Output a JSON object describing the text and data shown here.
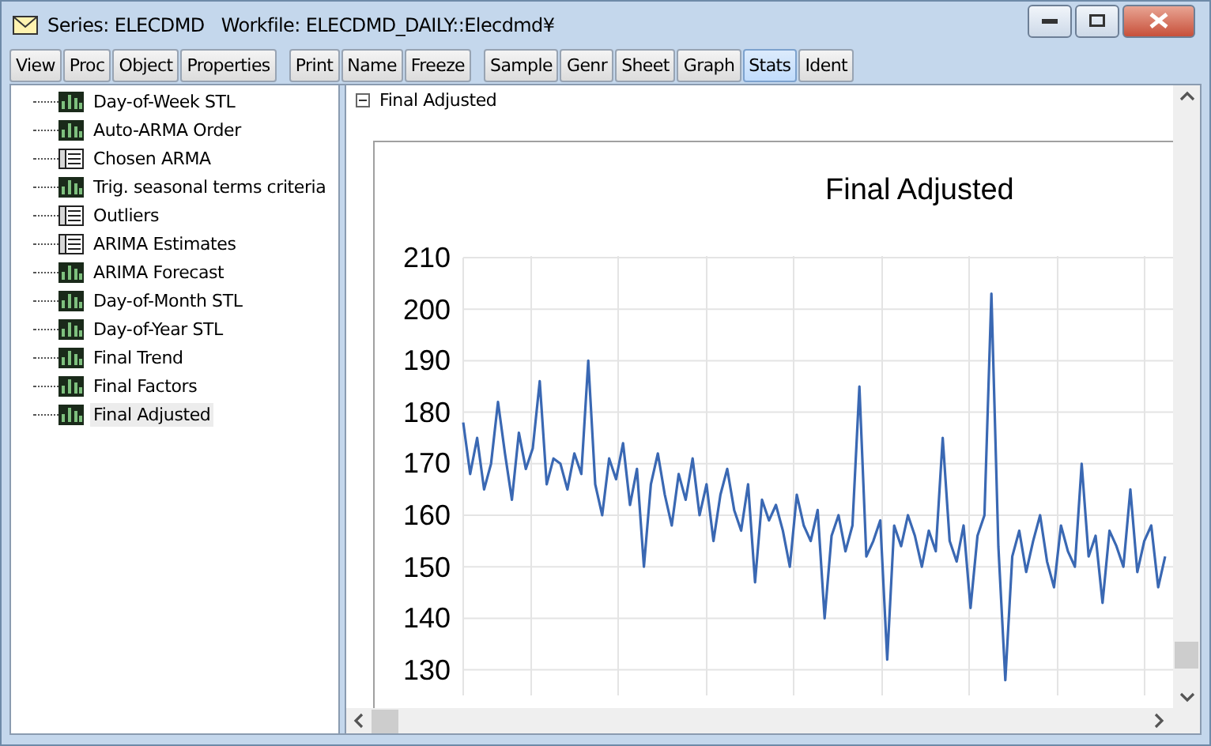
{
  "window": {
    "title": "Series: ELECDMD   Workfile: ELECDMD_DAILY::Elecdmd¥"
  },
  "toolbar": {
    "groups": [
      [
        {
          "label": "View",
          "selected": false
        },
        {
          "label": "Proc",
          "selected": false
        },
        {
          "label": "Object",
          "selected": false
        },
        {
          "label": "Properties",
          "selected": false
        }
      ],
      [
        {
          "label": "Print",
          "selected": false
        },
        {
          "label": "Name",
          "selected": false
        },
        {
          "label": "Freeze",
          "selected": false
        }
      ],
      [
        {
          "label": "Sample",
          "selected": false
        },
        {
          "label": "Genr",
          "selected": false
        },
        {
          "label": "Sheet",
          "selected": false
        },
        {
          "label": "Graph",
          "selected": false
        },
        {
          "label": "Stats",
          "selected": true
        },
        {
          "label": "Ident",
          "selected": false
        }
      ]
    ]
  },
  "tree": {
    "items": [
      {
        "label": "Day-of-Week STL",
        "kind": "graph",
        "selected": false
      },
      {
        "label": "Auto-ARMA Order",
        "kind": "graph",
        "selected": false
      },
      {
        "label": "Chosen ARMA",
        "kind": "table",
        "selected": false
      },
      {
        "label": "Trig. seasonal terms criteria",
        "kind": "graph",
        "selected": false
      },
      {
        "label": "Outliers",
        "kind": "table",
        "selected": false
      },
      {
        "label": "ARIMA Estimates",
        "kind": "table",
        "selected": false
      },
      {
        "label": "ARIMA Forecast",
        "kind": "graph",
        "selected": false
      },
      {
        "label": "Day-of-Month STL",
        "kind": "graph",
        "selected": false
      },
      {
        "label": "Day-of-Year STL",
        "kind": "graph",
        "selected": false
      },
      {
        "label": "Final Trend",
        "kind": "graph",
        "selected": false
      },
      {
        "label": "Final Factors",
        "kind": "graph",
        "selected": false
      },
      {
        "label": "Final Adjusted",
        "kind": "graph",
        "selected": true
      }
    ]
  },
  "view": {
    "section_label": "Final Adjusted",
    "chart_data": {
      "type": "line",
      "title": "Final Adjusted",
      "grid": true,
      "ylim": [
        125,
        210
      ],
      "yticks": [
        210,
        200,
        190,
        180,
        170,
        160,
        150,
        140,
        130
      ],
      "series": [
        {
          "color": "#3a68b3",
          "values": [
            178,
            168,
            175,
            165,
            170,
            182,
            172,
            163,
            176,
            169,
            173,
            186,
            166,
            171,
            170,
            165,
            172,
            168,
            190,
            166,
            160,
            171,
            167,
            174,
            162,
            169,
            150,
            166,
            172,
            164,
            158,
            168,
            163,
            171,
            160,
            166,
            155,
            164,
            169,
            161,
            157,
            166,
            147,
            163,
            159,
            162,
            157,
            150,
            164,
            158,
            155,
            161,
            140,
            156,
            160,
            153,
            158,
            185,
            152,
            155,
            159,
            132,
            158,
            154,
            160,
            156,
            150,
            157,
            153,
            175,
            155,
            151,
            158,
            142,
            156,
            160,
            203,
            154,
            128,
            152,
            157,
            149,
            155,
            160,
            151,
            146,
            158,
            153,
            150,
            170,
            152,
            156,
            143,
            157,
            154,
            150,
            165,
            149,
            155,
            158,
            146,
            152
          ]
        }
      ]
    }
  }
}
